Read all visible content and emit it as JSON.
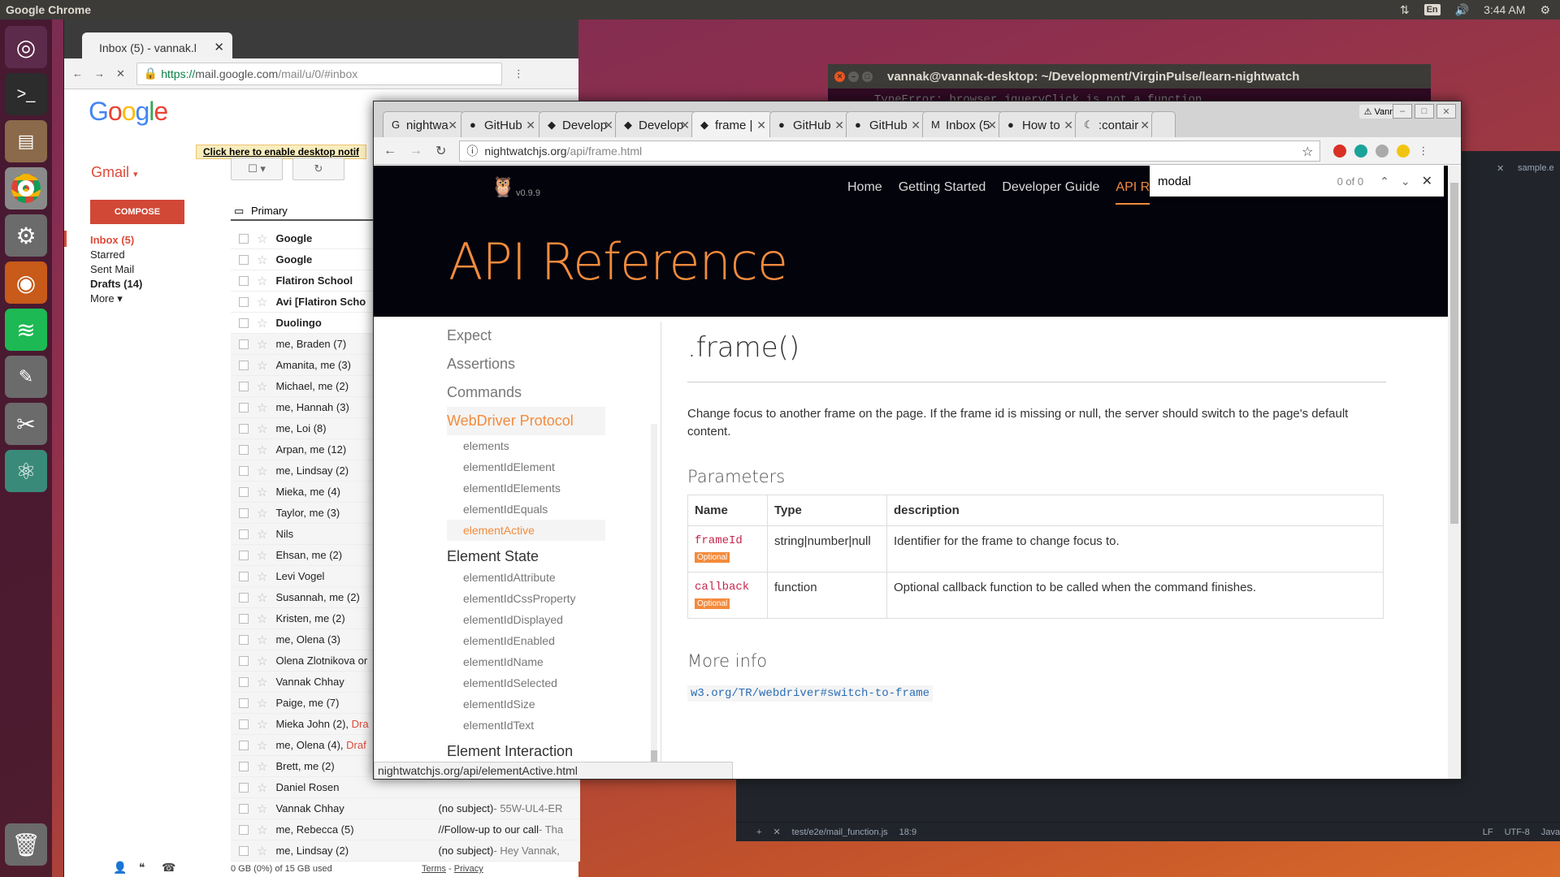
{
  "topbar": {
    "app_title": "Google Chrome",
    "lang": "En",
    "time": "3:44 AM"
  },
  "gmail": {
    "tab_title": "Inbox (5) - vannak.l",
    "url_secure": "https://",
    "url_host": "mail.google.com",
    "url_path": "/mail/u/0/#inbox",
    "logo": "Google",
    "app_label": "Gmail",
    "compose": "COMPOSE",
    "notif": "Click here to enable desktop notif",
    "nav": [
      {
        "label": "Inbox (5)"
      },
      {
        "label": "Starred"
      },
      {
        "label": "Sent Mail"
      },
      {
        "label": "Drafts (14)"
      },
      {
        "label": "More"
      }
    ],
    "primary_tab": "Primary",
    "rows": [
      {
        "from": "Google",
        "unread": true,
        "subj": "",
        "snip": ""
      },
      {
        "from": "Google",
        "unread": true,
        "subj": "",
        "snip": ""
      },
      {
        "from": "Flatiron School",
        "unread": true,
        "subj": "",
        "snip": ""
      },
      {
        "from": "Avi [Flatiron Scho",
        "unread": true,
        "subj": "",
        "snip": ""
      },
      {
        "from": "Duolingo",
        "unread": true,
        "subj": "",
        "snip": ""
      },
      {
        "from": "me, Braden (7)",
        "subj": "",
        "snip": ""
      },
      {
        "from": "Amanita, me (3)",
        "subj": "",
        "snip": ""
      },
      {
        "from": "Michael, me (2)",
        "subj": "",
        "snip": ""
      },
      {
        "from": "me, Hannah (3)",
        "subj": "",
        "snip": ""
      },
      {
        "from": "me, Loi (8)",
        "subj": "",
        "snip": ""
      },
      {
        "from": "Arpan, me (12)",
        "subj": "",
        "snip": ""
      },
      {
        "from": "me, Lindsay (2)",
        "subj": "",
        "snip": ""
      },
      {
        "from": "Mieka, me (4)",
        "subj": "",
        "snip": ""
      },
      {
        "from": "Taylor, me (3)",
        "subj": "",
        "snip": ""
      },
      {
        "from": "Nils",
        "subj": "",
        "snip": ""
      },
      {
        "from": "Ehsan, me (2)",
        "subj": "",
        "snip": ""
      },
      {
        "from": "Levi Vogel",
        "subj": "",
        "snip": ""
      },
      {
        "from": "Susannah, me (2)",
        "subj": "",
        "snip": ""
      },
      {
        "from": "Kristen, me (2)",
        "subj": "",
        "snip": ""
      },
      {
        "from": "me, Olena (3)",
        "subj": "",
        "snip": ""
      },
      {
        "from": "Olena Zlotnikova or",
        "subj": "",
        "snip": ""
      },
      {
        "from": "Vannak Chhay",
        "subj": "",
        "snip": ""
      },
      {
        "from": "Paige, me (7)",
        "subj": "",
        "snip": ""
      },
      {
        "from": "Mieka John (2),",
        "draft": "Dra",
        "subj": "",
        "snip": ""
      },
      {
        "from": "me, Olena (4),",
        "draft": "Draf",
        "subj": "",
        "snip": ""
      },
      {
        "from": "Brett, me (2)",
        "subj": "",
        "snip": ""
      },
      {
        "from": "Daniel Rosen",
        "subj": "",
        "snip": ""
      },
      {
        "from": "Vannak Chhay",
        "subj": "(no subject)",
        "snip": " - 55W-UL4-ER"
      },
      {
        "from": "me, Rebecca (5)",
        "subj": "//Follow-up to our call",
        "snip": " - Tha"
      },
      {
        "from": "me, Lindsay (2)",
        "subj": "(no subject)",
        "snip": " - Hey Vannak,"
      }
    ],
    "footer": {
      "storage": "0 GB (0%) of 15 GB used",
      "terms": "Terms",
      "sep": " - ",
      "privacy": "Privacy"
    }
  },
  "terminal": {
    "title": "vannak@vannak-desktop: ~/Development/VirginPulse/learn-nightwatch",
    "error": "TypeError: browser.jqueryClick is not a function"
  },
  "atom": {
    "tab": "sample.e",
    "status_file": "test/e2e/mail_function.js",
    "status_pos": "18:9",
    "status_lf": "LF",
    "status_enc": "UTF-8",
    "status_lang": "Java"
  },
  "chrome": {
    "tabs": [
      {
        "label": "nightwa",
        "icon": "G"
      },
      {
        "label": "GitHub",
        "icon": "●"
      },
      {
        "label": "Develop",
        "icon": "◆"
      },
      {
        "label": "Develop",
        "icon": "◆"
      },
      {
        "label": "frame |",
        "icon": "◆",
        "active": true
      },
      {
        "label": "GitHub",
        "icon": "●"
      },
      {
        "label": "GitHub",
        "icon": "●"
      },
      {
        "label": "Inbox (5",
        "icon": "M"
      },
      {
        "label": "How to",
        "icon": "●"
      },
      {
        "label": ":contair",
        "icon": "☾"
      }
    ],
    "profile": "Vannak",
    "url_host": "nightwatchjs.org",
    "url_path": "/api/frame.html",
    "status_url": "nightwatchjs.org/api/elementActive.html"
  },
  "site": {
    "version": "v0.9.9",
    "nav": [
      "Home",
      "Getting Started",
      "Developer Guide",
      "API R"
    ],
    "hero_title": "API Reference",
    "find": {
      "query": "modal",
      "count": "0 of 0"
    },
    "sidebar_main": [
      "Expect",
      "Assertions",
      "Commands",
      "WebDriver Protocol"
    ],
    "sidebar_sub1": [
      "elements",
      "elementIdElement",
      "elementIdElements",
      "elementIdEquals",
      "elementActive"
    ],
    "sidebar_head2": "Element State",
    "sidebar_sub2": [
      "elementIdAttribute",
      "elementIdCssProperty",
      "elementIdDisplayed",
      "elementIdEnabled",
      "elementIdName",
      "elementIdSelected",
      "elementIdSize",
      "elementIdText"
    ],
    "sidebar_head3": "Element Interaction",
    "title": ".frame()",
    "description": "Change focus to another frame on the page. If the frame id is missing or null, the server should switch to the page's default content.",
    "params_heading": "Parameters",
    "table_headers": [
      "Name",
      "Type",
      "description"
    ],
    "params": [
      {
        "name": "frameId",
        "optional": "Optional",
        "type": "string|number|null",
        "desc": "Identifier for the frame to change focus to."
      },
      {
        "name": "callback",
        "optional": "Optional",
        "type": "function",
        "desc": "Optional callback function to be called when the command finishes."
      }
    ],
    "more_heading": "More info",
    "more_link": "w3.org/TR/webdriver#switch-to-frame"
  }
}
